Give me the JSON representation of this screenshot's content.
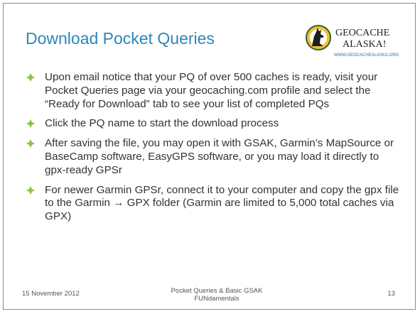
{
  "slide": {
    "title": "Download Pocket Queries",
    "logo": {
      "name_line1": "GEOCACHE",
      "name_line2": "ALASKA!",
      "url": "WWW.GEOCACHEALASKA.ORG"
    },
    "bullets": [
      {
        "text": "Upon email notice that your PQ of over 500 caches is ready, visit your Pocket Queries page via your geocaching.com profile and select the “Ready for Download” tab to see your list of completed PQs"
      },
      {
        "text": "Click the PQ name to start the download process"
      },
      {
        "text": "After saving the file, you may open it with GSAK, Garmin’s MapSource or BaseCamp software, EasyGPS software, or you may load it directly to gpx-ready GPSr"
      },
      {
        "text": "For newer Garmin GPSr, connect it to your computer and copy the gpx file to the Garmin → GPX folder (Garmin are limited to 5,000 total caches via GPX)"
      }
    ],
    "footer": {
      "date": "15 November  2012",
      "center": "Pocket Queries & Basic GSAK FUNdamentals",
      "page": "13"
    }
  },
  "colors": {
    "title": "#2c87b8",
    "bullet_icon": "#8cc63f",
    "text": "#333333"
  }
}
